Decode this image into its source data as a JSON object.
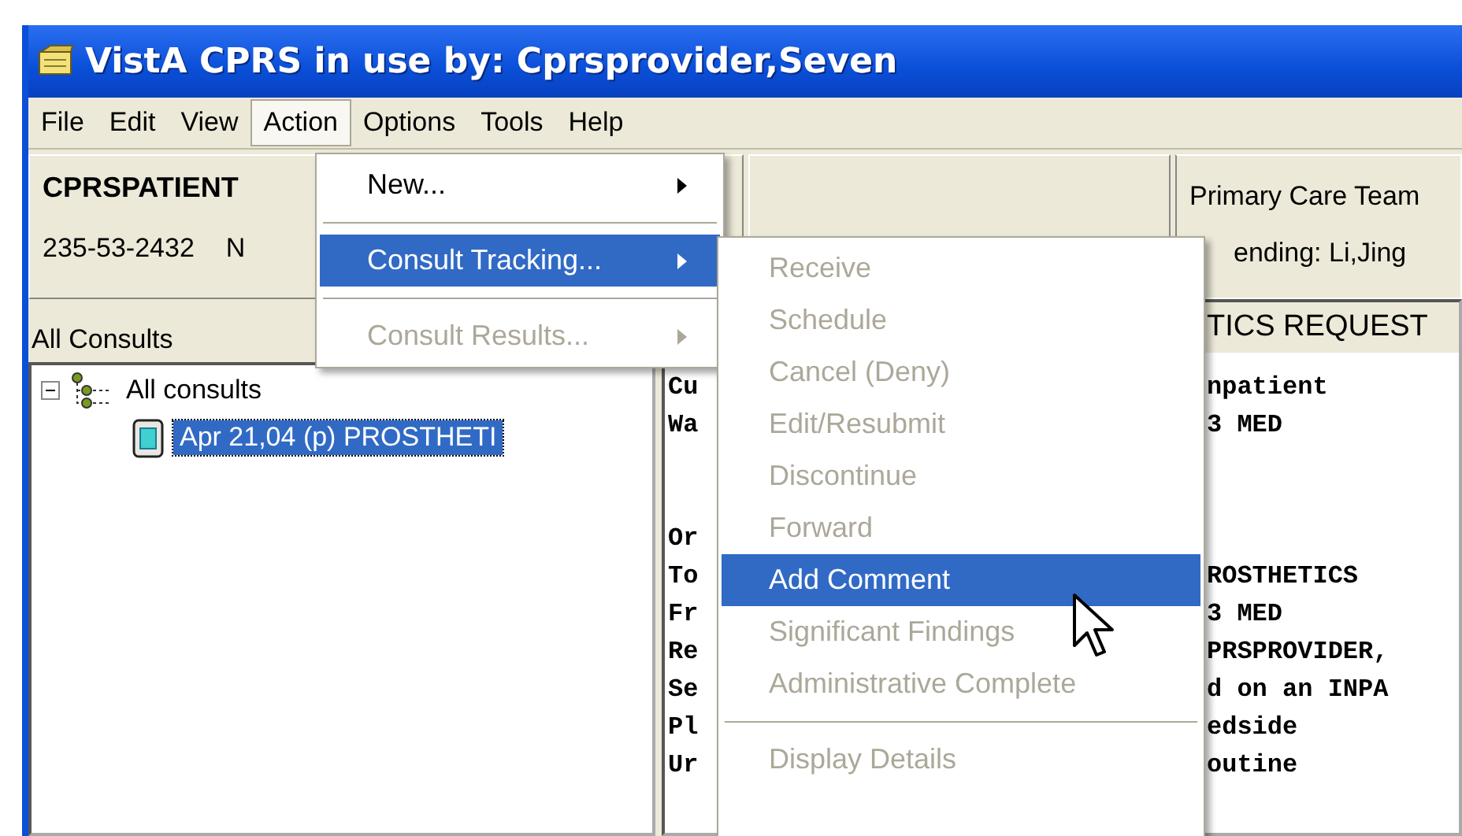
{
  "window": {
    "title": "VistA CPRS in use by: Cprsprovider,Seven"
  },
  "menu_bar": [
    {
      "label": "File",
      "selected": false
    },
    {
      "label": "Edit",
      "selected": false
    },
    {
      "label": "View",
      "selected": false
    },
    {
      "label": "Action",
      "selected": true
    },
    {
      "label": "Options",
      "selected": false
    },
    {
      "label": "Tools",
      "selected": false
    },
    {
      "label": "Help",
      "selected": false
    }
  ],
  "patient": {
    "name": "CPRSPATIENT",
    "ssn": "235-53-2432",
    "field_3": "N"
  },
  "primary_care": {
    "team": "Primary Care Team",
    "attending": "ending:  Li,Jing"
  },
  "consults_pane": {
    "title": "All Consults",
    "tree": [
      {
        "label": "All consults",
        "expanded": true,
        "selected": false,
        "children": [
          {
            "label": "Apr 21,04  (p) PROSTHETI",
            "selected": true
          }
        ]
      }
    ]
  },
  "details": {
    "header": "TICS REQUEST",
    "lines": [
      {
        "kind": "text",
        "left": "Cu",
        "right": "npatient"
      },
      {
        "kind": "text",
        "left": "Wa",
        "right": "3 MED"
      },
      {
        "kind": "blank"
      },
      {
        "kind": "blank"
      },
      {
        "kind": "text",
        "left": "Or"
      },
      {
        "kind": "text",
        "left": "To",
        "right": "ROSTHETICS"
      },
      {
        "kind": "text",
        "left": "Fr",
        "right": "3 MED"
      },
      {
        "kind": "text",
        "left": "Re",
        "right": "PRSPROVIDER,"
      },
      {
        "kind": "text",
        "left": "Se",
        "right": "d on an INPA"
      },
      {
        "kind": "text",
        "left": "Pl",
        "right": "edside"
      },
      {
        "kind": "text",
        "left": "Ur",
        "right": "outine"
      }
    ]
  },
  "action_menu": [
    {
      "kind": "item",
      "label": "New...",
      "submenu": true,
      "selected": false,
      "disabled": false
    },
    {
      "kind": "separator"
    },
    {
      "kind": "item",
      "label": "Consult Tracking...",
      "submenu": true,
      "selected": true,
      "disabled": false
    },
    {
      "kind": "separator"
    },
    {
      "kind": "item",
      "label": "Consult Results...",
      "submenu": true,
      "selected": false,
      "disabled": true
    }
  ],
  "submenu": [
    {
      "kind": "item",
      "label": "Receive",
      "selected": false,
      "disabled": true
    },
    {
      "kind": "item",
      "label": "Schedule",
      "selected": false,
      "disabled": true
    },
    {
      "kind": "item",
      "label": "Cancel (Deny)",
      "selected": false,
      "disabled": true
    },
    {
      "kind": "item",
      "label": "Edit/Resubmit",
      "selected": false,
      "disabled": true
    },
    {
      "kind": "item",
      "label": "Discontinue",
      "selected": false,
      "disabled": true
    },
    {
      "kind": "item",
      "label": "Forward",
      "selected": false,
      "disabled": true
    },
    {
      "kind": "item",
      "label": "Add Comment",
      "selected": true,
      "disabled": false
    },
    {
      "kind": "item",
      "label": "Significant Findings",
      "selected": false,
      "disabled": true
    },
    {
      "kind": "item",
      "label": "Administrative Complete",
      "selected": false,
      "disabled": true
    },
    {
      "kind": "separator"
    },
    {
      "kind": "item",
      "label": "Display Details",
      "selected": false,
      "disabled": true
    }
  ]
}
